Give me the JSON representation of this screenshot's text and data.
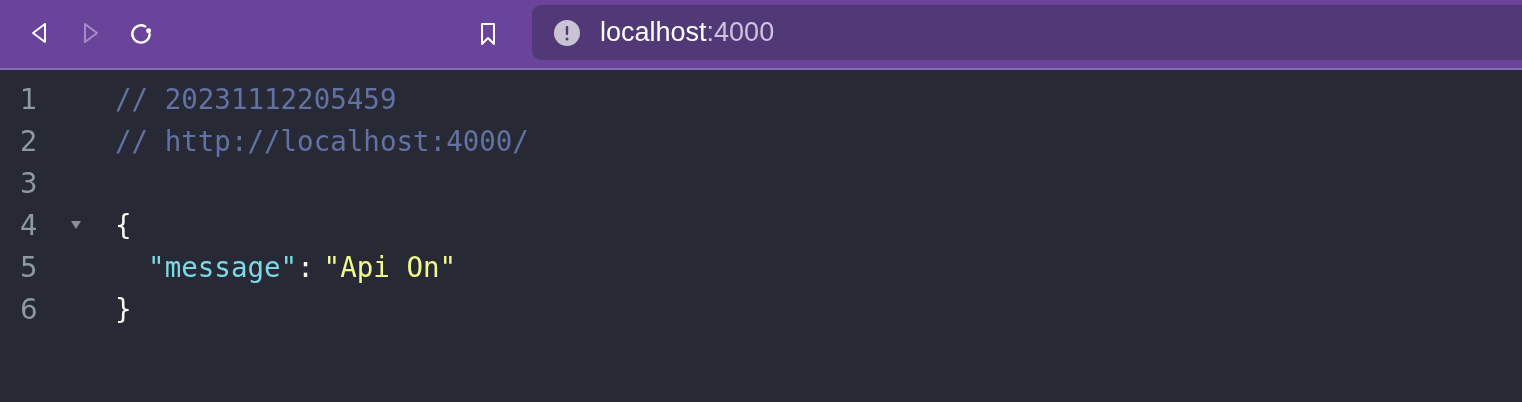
{
  "toolbar": {
    "back": {
      "disabled": false
    },
    "forward": {
      "disabled": true
    },
    "address": {
      "host": "localhost",
      "port": ":4000"
    }
  },
  "lines": [
    {
      "number": "1",
      "tokens": [
        {
          "kind": "comment",
          "text": "// 20231112205459"
        }
      ]
    },
    {
      "number": "2",
      "tokens": [
        {
          "kind": "comment",
          "text": "// http://localhost:4000/"
        }
      ]
    },
    {
      "number": "3"
    },
    {
      "number": "4",
      "expanded": true,
      "tokens": [
        {
          "kind": "punct",
          "text": "{"
        }
      ],
      "children": [
        {
          "number": "5",
          "tokens": [
            {
              "kind": "key",
              "text": "\"message\""
            },
            {
              "kind": "punct",
              "text": ":"
            },
            {
              "kind": "string",
              "text": "\"Api On\""
            }
          ]
        }
      ]
    },
    {
      "number": "6",
      "tokens": [
        {
          "kind": "punct",
          "text": "}"
        }
      ]
    }
  ]
}
